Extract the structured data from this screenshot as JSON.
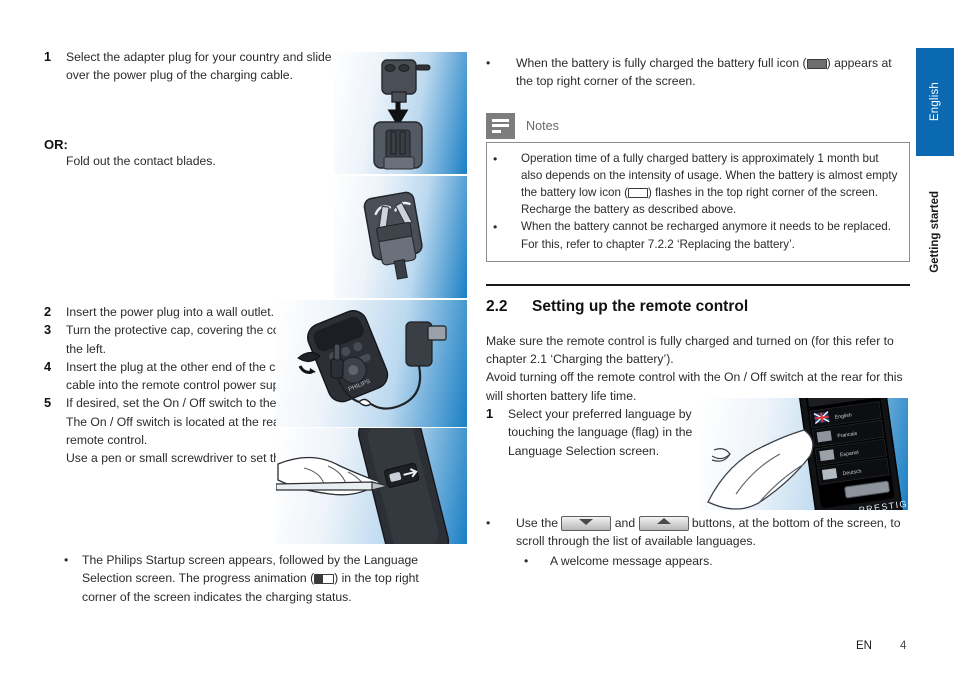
{
  "footer": {
    "lang_code": "EN",
    "page_number": "4"
  },
  "side_tab": {
    "language": "English",
    "section": "Getting started"
  },
  "left": {
    "step1": {
      "number": "1",
      "text": "Select the adapter plug for your country and slide it over the power plug of the charging cable."
    },
    "or_label": "OR:",
    "or_text": "Fold out the contact blades.",
    "step2": {
      "number": "2",
      "text": "Insert the power plug into a wall outlet."
    },
    "step3": {
      "number": "3",
      "text": "Turn the protective cap, covering the connectors, to the left."
    },
    "step4": {
      "number": "4",
      "text": "Insert the plug at the other end of the charging cable into the remote control power supply jack."
    },
    "step5": {
      "number": "5",
      "text": "If desired, set the On / Off switch to the right (On).",
      "text2": "The On / Off switch is located at the rear of the remote control.",
      "text3": "Use a pen or small screwdriver to set the switch."
    },
    "bullet_startup": {
      "dot": "•",
      "part1": "The Philips Startup screen appears, followed by the Language Selection screen. The progress animation (",
      "icon": "battery-progress-icon",
      "part2": ") in the top right corner of the screen indicates the charging status."
    }
  },
  "right": {
    "bullet_full": {
      "dot": "•",
      "part1": "When the battery is fully charged the battery full icon (",
      "icon": "battery-full-icon",
      "part2": ") appears at the top right corner of the screen."
    },
    "notes": {
      "icon": "notes-icon",
      "title": "Notes",
      "item1_part1": "Operation time of a fully charged battery is approximately 1 month but also depends on the intensity of usage. When the battery is almost empty the battery low icon (",
      "item1_icon": "battery-low-icon",
      "item1_part2": ") flashes in the top right corner of the screen. Recharge the battery as described above.",
      "item2": "When the battery cannot be recharged anymore it needs to be replaced. For this, refer to chapter 7.2.2 ‘Replacing the battery’.",
      "dot": "•"
    },
    "section": {
      "number": "2.2",
      "title": "Setting up the remote control"
    },
    "intro_line1": "Make sure the remote control is fully charged and turned on (for this refer to chapter 2.1 ‘Charging the battery’).",
    "intro_line2": "Avoid turning off the remote control with the On / Off switch at the rear for this will shorten battery life time.",
    "step1": {
      "number": "1",
      "text": "Select your preferred language by touching the language (flag) in the Language Selection screen."
    },
    "bullet_scroll": {
      "dot": "•",
      "part1": "Use the ",
      "icon_down": "scroll-down-button-icon",
      "part2": " and ",
      "icon_up": "scroll-up-button-icon",
      "part3": " buttons, at the bottom of the screen, to scroll through the list of available languages."
    },
    "bullet_welcome": {
      "dot": "•",
      "text": "A welcome message appears."
    }
  },
  "figures": {
    "fig1": "adapter-plug-slide-illustration",
    "fig2": "adapter-contact-blades-illustration",
    "fig3": "remote-charging-cable-illustration",
    "fig4": "onoff-switch-pen-illustration",
    "fig5": "language-selection-touch-illustration"
  },
  "colors": {
    "accent_blue": "#0a69b0",
    "notes_gray": "#7d7d7d",
    "rule_black": "#1a1a1a"
  }
}
